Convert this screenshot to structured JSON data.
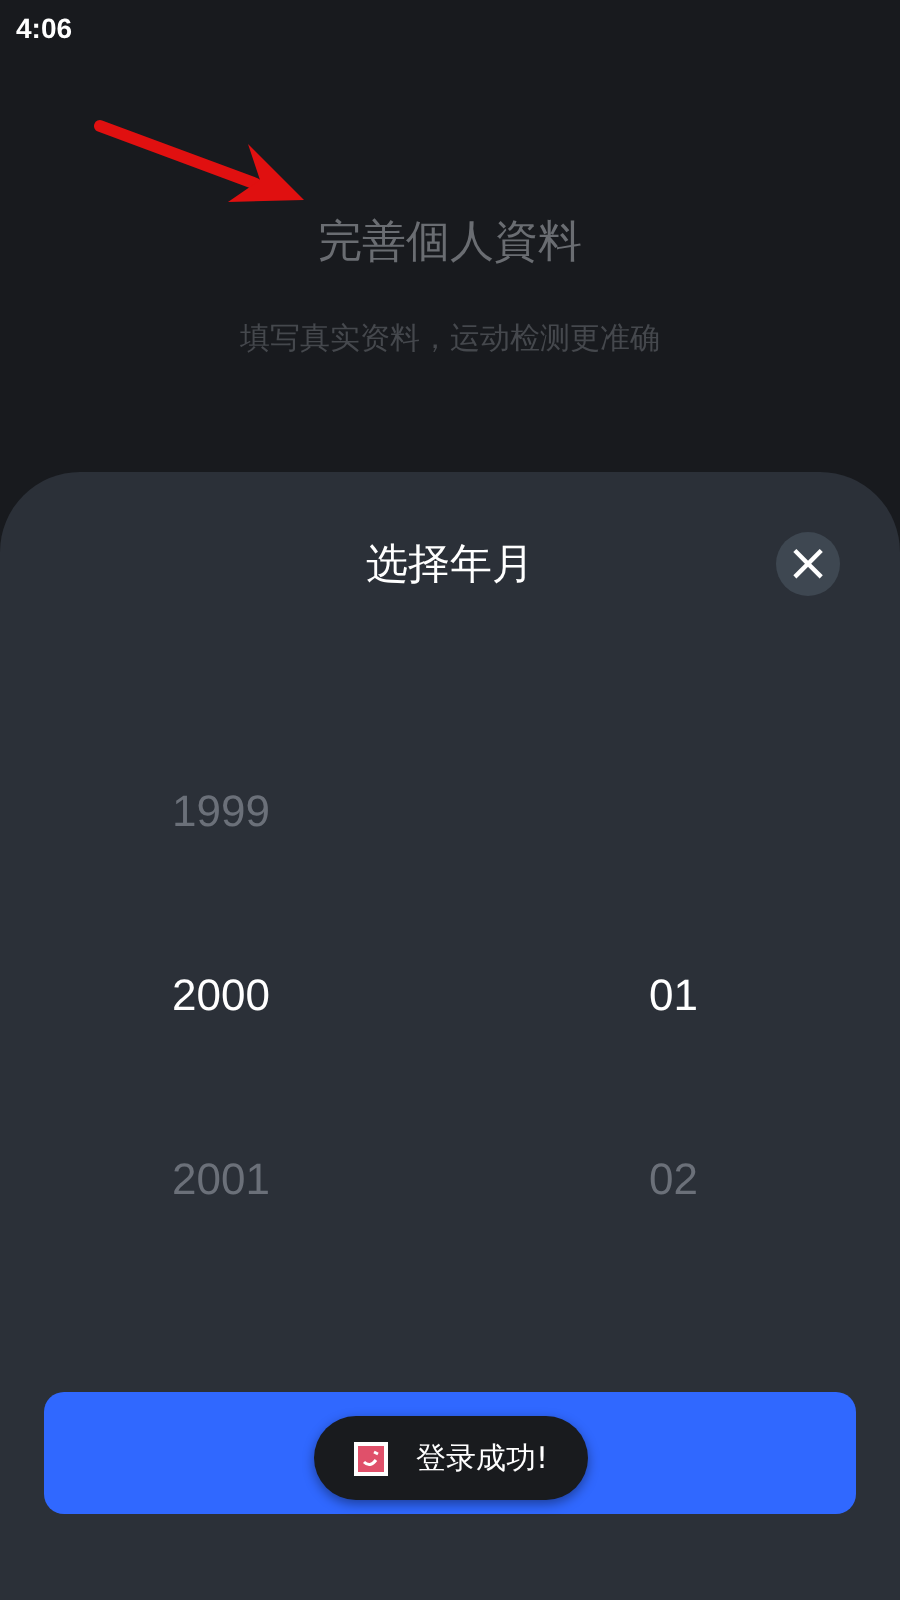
{
  "status_bar": {
    "time": "4:06"
  },
  "header": {
    "title": "完善個人資料",
    "subtitle": "填写真实资料，运动检测更准确"
  },
  "sheet": {
    "title": "选择年月",
    "close": "×",
    "columns": [
      {
        "kind": "year",
        "items": [
          {
            "label": "1999",
            "selected": false
          },
          {
            "label": "2000",
            "selected": true
          },
          {
            "label": "2001",
            "selected": false
          }
        ]
      },
      {
        "kind": "month",
        "items": [
          {
            "label": "01",
            "selected": true
          },
          {
            "label": "02",
            "selected": false
          }
        ]
      }
    ]
  },
  "toast": {
    "text": "登录成功!"
  }
}
